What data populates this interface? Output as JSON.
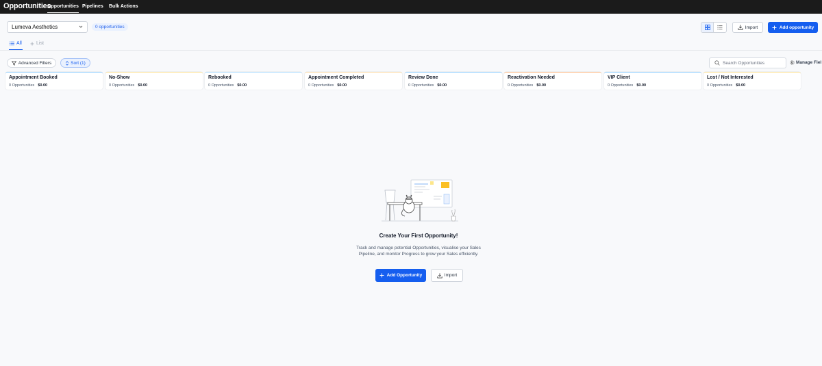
{
  "topnav": {
    "title": "Opportunities",
    "tabs": [
      {
        "label": "Opportunities",
        "active": true
      },
      {
        "label": "Pipelines",
        "active": false
      },
      {
        "label": "Bulk Actions",
        "active": false
      }
    ]
  },
  "header": {
    "pipeline_selected": "Lumeva Aesthetics",
    "count_badge": "0 opportunities",
    "import_label": "Import",
    "add_label": "Add opportunity"
  },
  "view_tabs": {
    "all_label": "All",
    "list_label": "List"
  },
  "filters": {
    "advanced_label": "Advanced Filters",
    "sort_label": "Sort (1)",
    "search_placeholder": "Search Opportunities",
    "manage_fields_label": "Manage Fiel"
  },
  "stages": [
    {
      "name": "Appointment Booked",
      "count": "0 Opportunities",
      "amount": "$0.00",
      "color": "#84caff"
    },
    {
      "name": "No-Show",
      "count": "0 Opportunities",
      "amount": "$0.00",
      "color": "#fedf89"
    },
    {
      "name": "Rebooked",
      "count": "0 Opportunities",
      "amount": "$0.00",
      "color": "#a6d8ff"
    },
    {
      "name": "Appointment Completed",
      "count": "0 Opportunities",
      "amount": "$0.00",
      "color": "#fdd69b"
    },
    {
      "name": "Review Done",
      "count": "0 Opportunities",
      "amount": "$0.00",
      "color": "#84caff"
    },
    {
      "name": "Reactivation Needed",
      "count": "0 Opportunities",
      "amount": "$0.00",
      "color": "#fdb37a"
    },
    {
      "name": "VIP Client",
      "count": "0 Opportunities",
      "amount": "$0.00",
      "color": "#84caff"
    },
    {
      "name": "Lost / Not Interested",
      "count": "0 Opportunities",
      "amount": "$0.00",
      "color": "#fedf89"
    }
  ],
  "empty_state": {
    "title": "Create Your First Opportunity!",
    "description": "Track and manage potential Opportunities, visualise your Sales Pipeline, and monitor Progress to grow your Sales efficiently.",
    "add_label": "Add Opportunity",
    "import_label": "Import"
  },
  "colors": {
    "primary": "#155eef",
    "nav_bg": "#1b1b1b",
    "page_bg": "#f8f9fb"
  }
}
